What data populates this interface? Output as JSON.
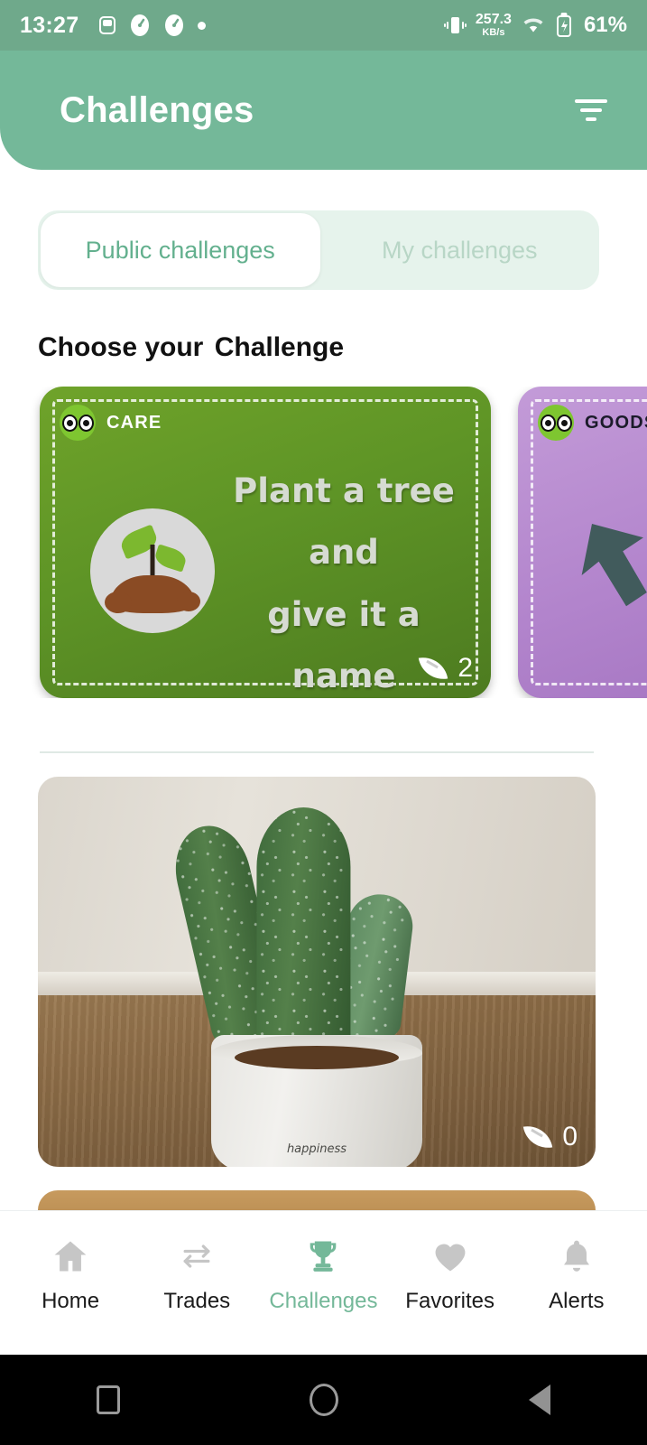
{
  "status_bar": {
    "time": "13:27",
    "network_speed_value": "257.3",
    "network_speed_unit": "KB/s",
    "battery_percent": "61%",
    "icons": [
      "sim-icon",
      "speedometer-icon",
      "speedometer-icon",
      "dot-icon",
      "vibrate-icon",
      "wifi-icon",
      "battery-charging-icon"
    ]
  },
  "appbar": {
    "title": "Challenges",
    "filter_icon": "filter-icon",
    "background_color": "#74b899"
  },
  "tabs": {
    "active_index": 0,
    "items": [
      {
        "label": "Public challenges",
        "active": true
      },
      {
        "label": "My challenges",
        "active": false
      }
    ]
  },
  "section": {
    "title_prefix": "Choose your ",
    "title_highlight": "Challenge",
    "highlight_color": "#7fbda2"
  },
  "challenge_cards": [
    {
      "category": "CARE",
      "title_lines": [
        "Plant a tree",
        "and",
        "give it a name"
      ],
      "leaf_count": "2",
      "color": "#5e9426",
      "image": "seedling-illustration"
    },
    {
      "category": "GOODS -",
      "title_lines": [],
      "leaf_count": "",
      "color": "#b284cc",
      "image": "recycle-illustration"
    }
  ],
  "feed": [
    {
      "image": "cactus-in-white-pot-photo",
      "leaf_count": "0",
      "pot_text": "happiness"
    },
    {
      "image": "partial-photo",
      "leaf_count": ""
    }
  ],
  "bottom_nav": {
    "active_index": 2,
    "items": [
      {
        "label": "Home",
        "icon": "home-icon"
      },
      {
        "label": "Trades",
        "icon": "swap-arrows-icon"
      },
      {
        "label": "Challenges",
        "icon": "trophy-icon"
      },
      {
        "label": "Favorites",
        "icon": "heart-icon"
      },
      {
        "label": "Alerts",
        "icon": "bell-icon"
      }
    ],
    "active_color": "#74b899",
    "inactive_color": "#c6c6c6"
  },
  "system_nav": {
    "buttons": [
      "recents-square-icon",
      "home-circle-icon",
      "back-triangle-icon"
    ]
  }
}
